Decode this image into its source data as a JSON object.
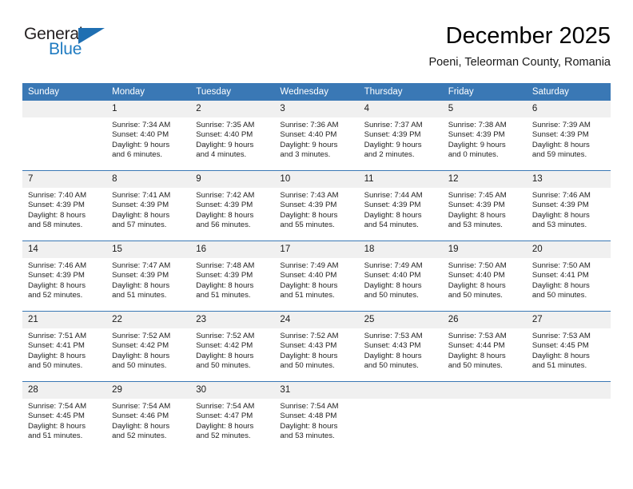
{
  "brand": {
    "name_part1": "General",
    "name_part2": "Blue",
    "accent_color": "#1f7bc1",
    "triangle_color": "#1f6fb2"
  },
  "header": {
    "title": "December 2025",
    "subtitle": "Poeni, Teleorman County, Romania"
  },
  "calendar": {
    "header_bg": "#3a78b5",
    "daynum_bg": "#f0f0f0",
    "weekdays": [
      "Sunday",
      "Monday",
      "Tuesday",
      "Wednesday",
      "Thursday",
      "Friday",
      "Saturday"
    ],
    "weeks": [
      [
        {
          "day": "",
          "empty": true,
          "lines": []
        },
        {
          "day": "1",
          "lines": [
            "Sunrise: 7:34 AM",
            "Sunset: 4:40 PM",
            "Daylight: 9 hours",
            "and 6 minutes."
          ]
        },
        {
          "day": "2",
          "lines": [
            "Sunrise: 7:35 AM",
            "Sunset: 4:40 PM",
            "Daylight: 9 hours",
            "and 4 minutes."
          ]
        },
        {
          "day": "3",
          "lines": [
            "Sunrise: 7:36 AM",
            "Sunset: 4:40 PM",
            "Daylight: 9 hours",
            "and 3 minutes."
          ]
        },
        {
          "day": "4",
          "lines": [
            "Sunrise: 7:37 AM",
            "Sunset: 4:39 PM",
            "Daylight: 9 hours",
            "and 2 minutes."
          ]
        },
        {
          "day": "5",
          "lines": [
            "Sunrise: 7:38 AM",
            "Sunset: 4:39 PM",
            "Daylight: 9 hours",
            "and 0 minutes."
          ]
        },
        {
          "day": "6",
          "lines": [
            "Sunrise: 7:39 AM",
            "Sunset: 4:39 PM",
            "Daylight: 8 hours",
            "and 59 minutes."
          ]
        }
      ],
      [
        {
          "day": "7",
          "lines": [
            "Sunrise: 7:40 AM",
            "Sunset: 4:39 PM",
            "Daylight: 8 hours",
            "and 58 minutes."
          ]
        },
        {
          "day": "8",
          "lines": [
            "Sunrise: 7:41 AM",
            "Sunset: 4:39 PM",
            "Daylight: 8 hours",
            "and 57 minutes."
          ]
        },
        {
          "day": "9",
          "lines": [
            "Sunrise: 7:42 AM",
            "Sunset: 4:39 PM",
            "Daylight: 8 hours",
            "and 56 minutes."
          ]
        },
        {
          "day": "10",
          "lines": [
            "Sunrise: 7:43 AM",
            "Sunset: 4:39 PM",
            "Daylight: 8 hours",
            "and 55 minutes."
          ]
        },
        {
          "day": "11",
          "lines": [
            "Sunrise: 7:44 AM",
            "Sunset: 4:39 PM",
            "Daylight: 8 hours",
            "and 54 minutes."
          ]
        },
        {
          "day": "12",
          "lines": [
            "Sunrise: 7:45 AM",
            "Sunset: 4:39 PM",
            "Daylight: 8 hours",
            "and 53 minutes."
          ]
        },
        {
          "day": "13",
          "lines": [
            "Sunrise: 7:46 AM",
            "Sunset: 4:39 PM",
            "Daylight: 8 hours",
            "and 53 minutes."
          ]
        }
      ],
      [
        {
          "day": "14",
          "lines": [
            "Sunrise: 7:46 AM",
            "Sunset: 4:39 PM",
            "Daylight: 8 hours",
            "and 52 minutes."
          ]
        },
        {
          "day": "15",
          "lines": [
            "Sunrise: 7:47 AM",
            "Sunset: 4:39 PM",
            "Daylight: 8 hours",
            "and 51 minutes."
          ]
        },
        {
          "day": "16",
          "lines": [
            "Sunrise: 7:48 AM",
            "Sunset: 4:39 PM",
            "Daylight: 8 hours",
            "and 51 minutes."
          ]
        },
        {
          "day": "17",
          "lines": [
            "Sunrise: 7:49 AM",
            "Sunset: 4:40 PM",
            "Daylight: 8 hours",
            "and 51 minutes."
          ]
        },
        {
          "day": "18",
          "lines": [
            "Sunrise: 7:49 AM",
            "Sunset: 4:40 PM",
            "Daylight: 8 hours",
            "and 50 minutes."
          ]
        },
        {
          "day": "19",
          "lines": [
            "Sunrise: 7:50 AM",
            "Sunset: 4:40 PM",
            "Daylight: 8 hours",
            "and 50 minutes."
          ]
        },
        {
          "day": "20",
          "lines": [
            "Sunrise: 7:50 AM",
            "Sunset: 4:41 PM",
            "Daylight: 8 hours",
            "and 50 minutes."
          ]
        }
      ],
      [
        {
          "day": "21",
          "lines": [
            "Sunrise: 7:51 AM",
            "Sunset: 4:41 PM",
            "Daylight: 8 hours",
            "and 50 minutes."
          ]
        },
        {
          "day": "22",
          "lines": [
            "Sunrise: 7:52 AM",
            "Sunset: 4:42 PM",
            "Daylight: 8 hours",
            "and 50 minutes."
          ]
        },
        {
          "day": "23",
          "lines": [
            "Sunrise: 7:52 AM",
            "Sunset: 4:42 PM",
            "Daylight: 8 hours",
            "and 50 minutes."
          ]
        },
        {
          "day": "24",
          "lines": [
            "Sunrise: 7:52 AM",
            "Sunset: 4:43 PM",
            "Daylight: 8 hours",
            "and 50 minutes."
          ]
        },
        {
          "day": "25",
          "lines": [
            "Sunrise: 7:53 AM",
            "Sunset: 4:43 PM",
            "Daylight: 8 hours",
            "and 50 minutes."
          ]
        },
        {
          "day": "26",
          "lines": [
            "Sunrise: 7:53 AM",
            "Sunset: 4:44 PM",
            "Daylight: 8 hours",
            "and 50 minutes."
          ]
        },
        {
          "day": "27",
          "lines": [
            "Sunrise: 7:53 AM",
            "Sunset: 4:45 PM",
            "Daylight: 8 hours",
            "and 51 minutes."
          ]
        }
      ],
      [
        {
          "day": "28",
          "lines": [
            "Sunrise: 7:54 AM",
            "Sunset: 4:45 PM",
            "Daylight: 8 hours",
            "and 51 minutes."
          ]
        },
        {
          "day": "29",
          "lines": [
            "Sunrise: 7:54 AM",
            "Sunset: 4:46 PM",
            "Daylight: 8 hours",
            "and 52 minutes."
          ]
        },
        {
          "day": "30",
          "lines": [
            "Sunrise: 7:54 AM",
            "Sunset: 4:47 PM",
            "Daylight: 8 hours",
            "and 52 minutes."
          ]
        },
        {
          "day": "31",
          "lines": [
            "Sunrise: 7:54 AM",
            "Sunset: 4:48 PM",
            "Daylight: 8 hours",
            "and 53 minutes."
          ]
        },
        {
          "day": "",
          "empty": true,
          "lines": []
        },
        {
          "day": "",
          "empty": true,
          "lines": []
        },
        {
          "day": "",
          "empty": true,
          "lines": []
        }
      ]
    ]
  }
}
